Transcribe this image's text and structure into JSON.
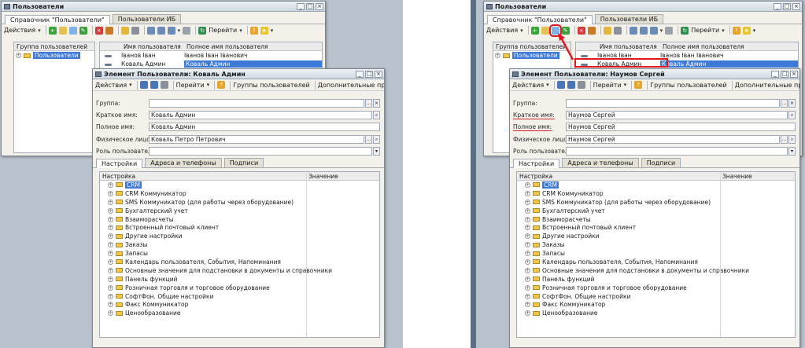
{
  "left": {
    "main_window": {
      "title": "Пользователи",
      "tabs": [
        "Справочник \"Пользователи\"",
        "Пользователи ИБ"
      ],
      "actions_label": "Действия",
      "goto_label": "Перейти",
      "group_header": "Группа пользователей",
      "group_item": "Пользователи",
      "list_headers": [
        "Имя пользователя",
        "Полное имя пользователя"
      ],
      "list_rows": [
        {
          "name": "Іванов Іван",
          "full": "Іванов Іван Іванович"
        },
        {
          "name": "Коваль Админ",
          "full": "Коваль Админ"
        }
      ]
    },
    "element_window": {
      "title": "Элемент Пользователи: Коваль Админ",
      "actions_label": "Действия",
      "goto_label": "Перейти",
      "groups_label": "Группы пользователей",
      "rights_label": "Дополнительные права",
      "fields": {
        "group_label": "Группа:",
        "group_value": "",
        "short_label": "Краткое имя:",
        "short_value": "Коваль Админ",
        "full_label": "Полное имя:",
        "full_value": "Коваль Админ",
        "person_label": "Физическое лицо:",
        "person_value": "Коваль Петро Петрович",
        "role_label": "Роль пользователя:",
        "role_value": ""
      }
    }
  },
  "right": {
    "main_window": {
      "title": "Пользователи",
      "tabs": [
        "Справочник \"Пользователи\"",
        "Пользователи ИБ"
      ],
      "actions_label": "Действия",
      "goto_label": "Перейти",
      "group_header": "Группа пользователей",
      "group_item": "Пользователи",
      "list_headers": [
        "Имя пользователя",
        "Полное имя пользователя"
      ],
      "list_rows": [
        {
          "name": "Іванов Іван",
          "full": "Іванов Іван Іванович"
        },
        {
          "name": "Коваль Админ",
          "full": "Коваль Админ"
        }
      ]
    },
    "element_window": {
      "title": "Элемент Пользователи: Наумов Сергей",
      "actions_label": "Действия",
      "goto_label": "Перейти",
      "groups_label": "Группы пользователей",
      "rights_label": "Дополнительные права",
      "fields": {
        "group_label": "Группа:",
        "group_value": "",
        "short_label": "Краткое имя:",
        "short_value": "Наумов Сергей",
        "full_label": "Полное имя:",
        "full_value": "Наумов Сергей",
        "person_label": "Физическое лицо:",
        "person_value": "Наумов Сергей",
        "role_label": "Роль пользователя:",
        "role_value": ""
      }
    }
  },
  "inner_tabs": [
    "Настройки",
    "Адреса и телефоны",
    "Подписи"
  ],
  "settings_headers": [
    "Настройка",
    "Значение"
  ],
  "settings_items": [
    "CRM",
    "CRM Коммуникатор",
    "SMS Коммуникатор (для работы через оборудование)",
    "Бухгалтерский учет",
    "Взаиморасчеты",
    "Встроенный почтовый клиент",
    "Другие настройки",
    "Заказы",
    "Запасы",
    "Календарь пользователя, События, Напоминания",
    "Основные значения для подстановки в документы и справочники",
    "Панель функций",
    "Розничная торговля и торговое оборудование",
    "СофтФон. Общие настройки",
    "Факс Коммуникатор",
    "Ценообразование"
  ],
  "colors": {
    "highlight": "#e0171f",
    "selection": "#3d7ad8",
    "desktop": "#b9c3cd"
  }
}
